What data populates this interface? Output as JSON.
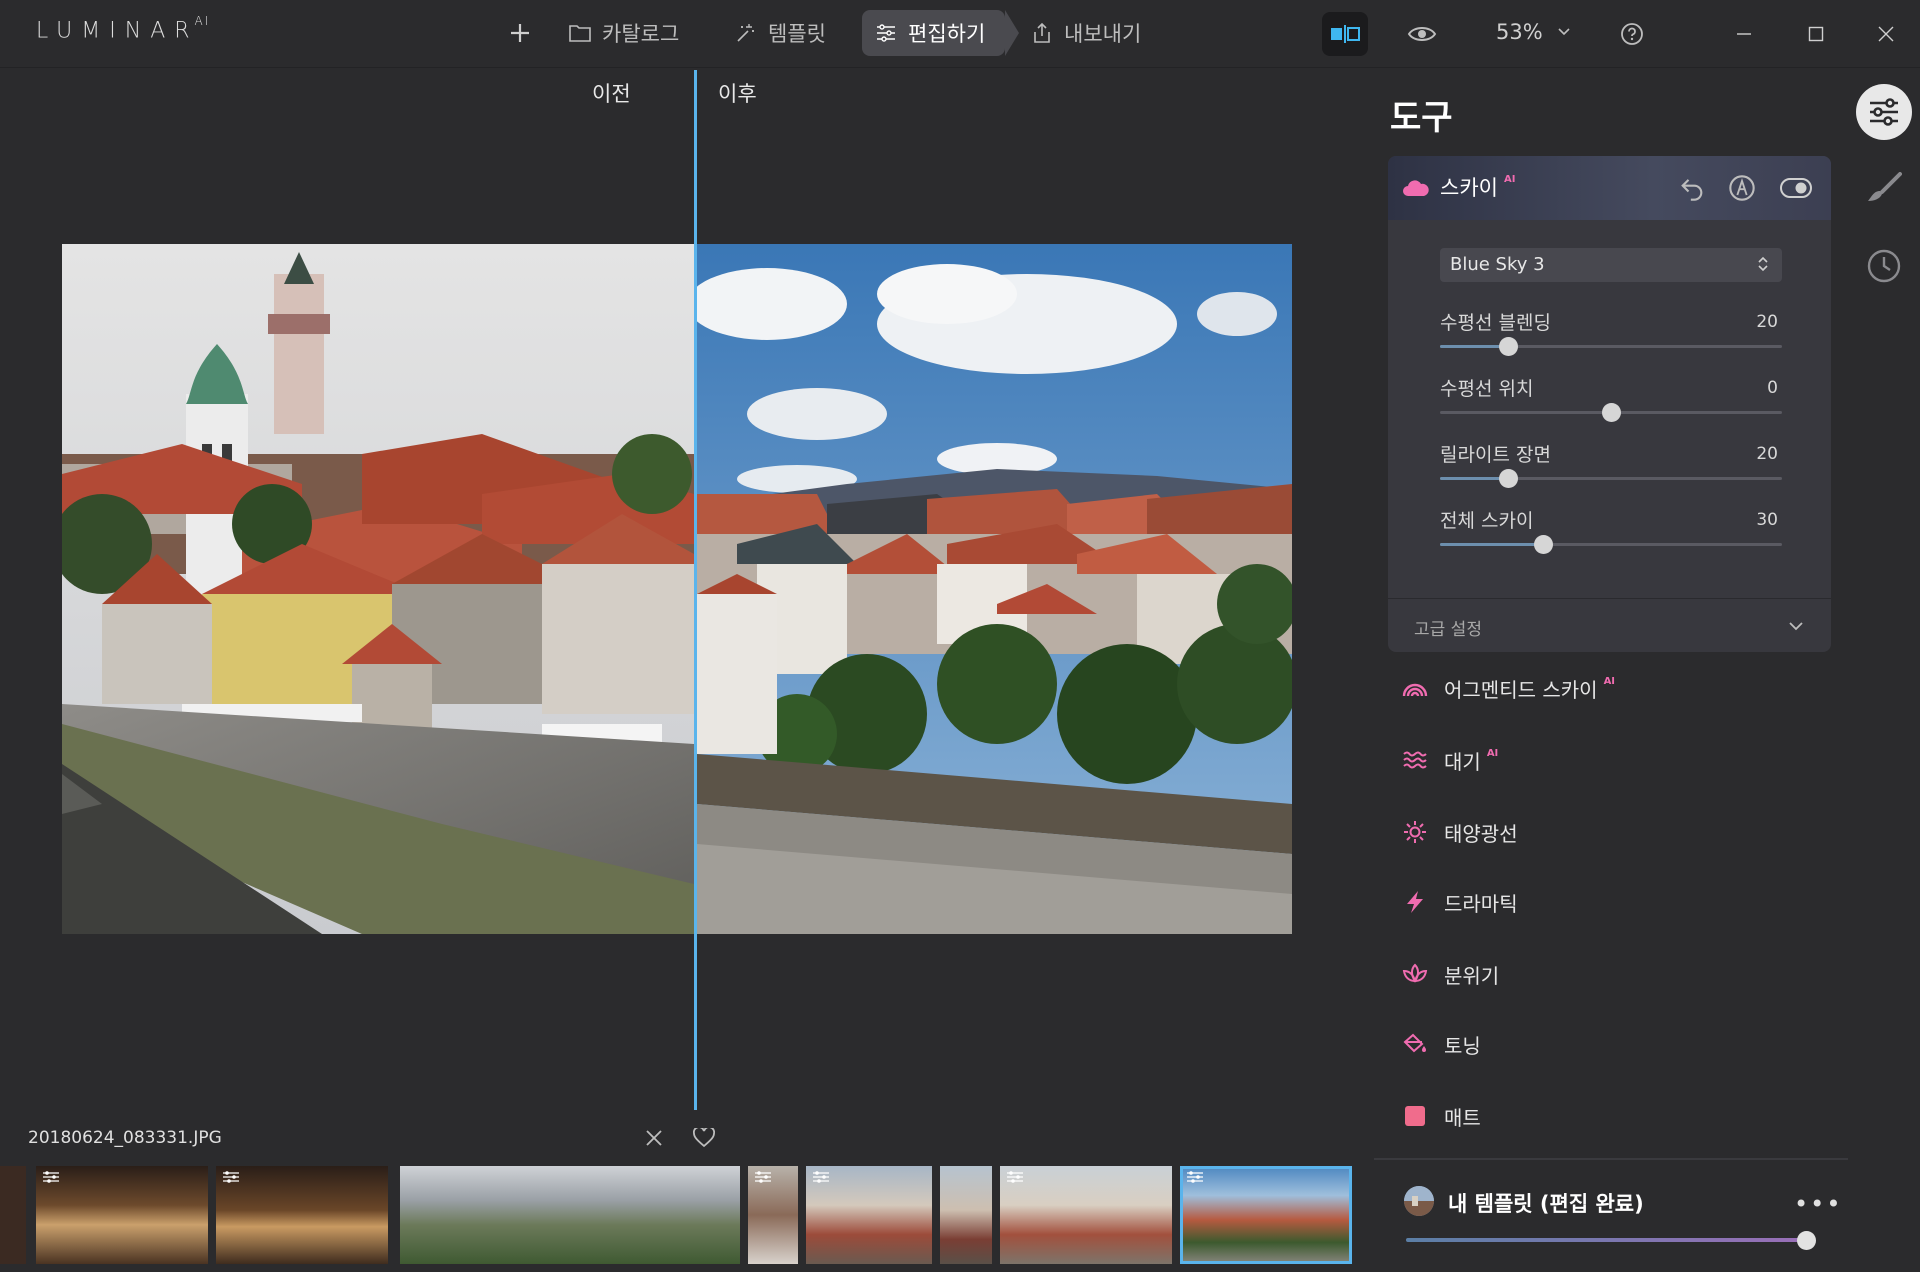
{
  "app": {
    "logo": "LUMINAR",
    "logo_sup": "AI"
  },
  "nav": {
    "catalog": "카탈로그",
    "templates": "템플릿",
    "edit": "편집하기",
    "export": "내보내기"
  },
  "toolbar": {
    "zoom": "53%"
  },
  "canvas": {
    "before_label": "이전",
    "after_label": "이후",
    "filename": "20180624_083331.JPG"
  },
  "tools": {
    "title": "도구",
    "sky": {
      "name": "스카이",
      "ai_tag": "AI",
      "sky_preset": "Blue Sky 3",
      "sliders": [
        {
          "label": "수평선 블렌딩",
          "value": 20,
          "display": "20",
          "min": 0,
          "max": 100
        },
        {
          "label": "수평선 위치",
          "value": 0,
          "display": "0",
          "min": -100,
          "max": 100
        },
        {
          "label": "릴라이트 장면",
          "value": 20,
          "display": "20",
          "min": 0,
          "max": 100
        },
        {
          "label": "전체 스카이",
          "value": 30,
          "display": "30",
          "min": 0,
          "max": 100
        }
      ],
      "advanced_label": "고급 설정"
    },
    "items": [
      {
        "label": "어그멘티드 스카이",
        "ai": "AI",
        "icon": "rainbow-icon"
      },
      {
        "label": "대기",
        "ai": "AI",
        "icon": "waves-icon"
      },
      {
        "label": "태양광선",
        "ai": "",
        "icon": "sun-icon"
      },
      {
        "label": "드라마틱",
        "ai": "",
        "icon": "lightning-icon"
      },
      {
        "label": "분위기",
        "ai": "",
        "icon": "lotus-icon"
      },
      {
        "label": "토닝",
        "ai": "",
        "icon": "paint-bucket-icon"
      },
      {
        "label": "매트",
        "ai": "",
        "icon": "square-icon"
      }
    ]
  },
  "preset": {
    "title": "내 템플릿 (편집 완료)",
    "more": "•••",
    "amount": 100
  },
  "colors": {
    "accent_blue": "#5ab4ec",
    "tool_pink": "#f06cb0"
  }
}
